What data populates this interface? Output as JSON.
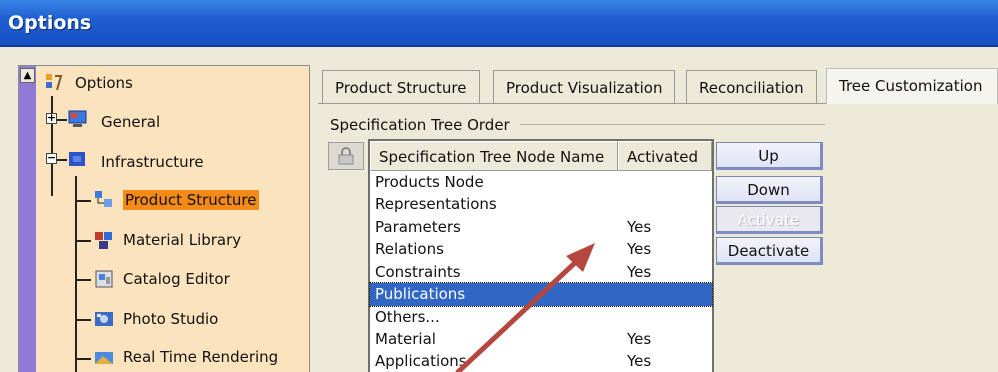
{
  "window": {
    "title": "Options"
  },
  "tree": {
    "items": [
      {
        "label": "Options",
        "icon": "options-root-icon"
      },
      {
        "label": "General",
        "icon": "general-icon"
      },
      {
        "label": "Infrastructure",
        "icon": "infrastructure-icon"
      },
      {
        "label": "Product Structure",
        "icon": "product-structure-icon",
        "selected": true
      },
      {
        "label": "Material Library",
        "icon": "material-library-icon"
      },
      {
        "label": "Catalog Editor",
        "icon": "catalog-editor-icon"
      },
      {
        "label": "Photo Studio",
        "icon": "photo-studio-icon"
      },
      {
        "label": "Real Time Rendering",
        "icon": "real-time-rendering-icon"
      }
    ]
  },
  "tabs": [
    {
      "label": "Product Structure"
    },
    {
      "label": "Product Visualization"
    },
    {
      "label": "Reconciliation"
    },
    {
      "label": "Tree Customization",
      "active": true
    }
  ],
  "group": {
    "title": "Specification Tree Order"
  },
  "list": {
    "columns": [
      "Specification Tree Node Name",
      "Activated"
    ],
    "rows": [
      {
        "name": "Products Node",
        "activated": ""
      },
      {
        "name": "Representations",
        "activated": ""
      },
      {
        "name": "Parameters",
        "activated": "Yes"
      },
      {
        "name": "Relations",
        "activated": "Yes"
      },
      {
        "name": "Constraints",
        "activated": "Yes"
      },
      {
        "name": "Publications",
        "activated": "",
        "selected": true
      },
      {
        "name": "Others...",
        "activated": ""
      },
      {
        "name": "Material",
        "activated": "Yes"
      },
      {
        "name": "Applications",
        "activated": "Yes"
      }
    ]
  },
  "buttons": {
    "up": "Up",
    "down": "Down",
    "activate": "Activate",
    "deactivate": "Deactivate"
  },
  "colors": {
    "title_bar": "#1f5fd1",
    "tree_background": "#fbe3bd",
    "tree_selected": "#f58a16",
    "list_selected": "#3166c4",
    "annotation_arrow": "#b5473f"
  }
}
